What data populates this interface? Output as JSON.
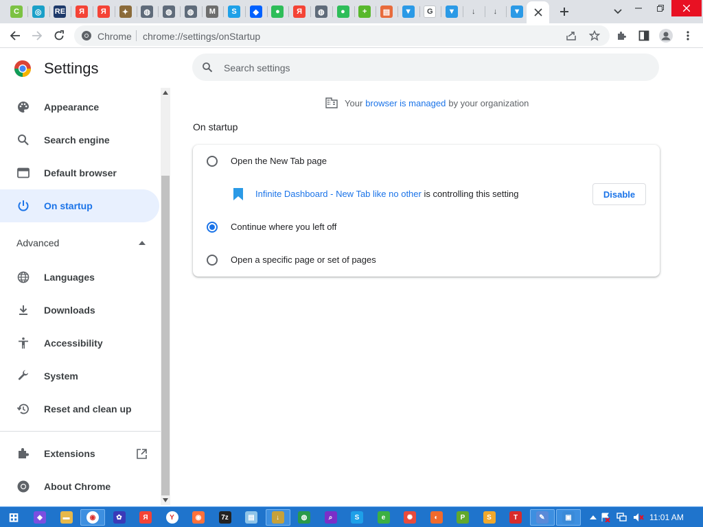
{
  "window": {
    "title": "Settings"
  },
  "tabs": [
    {
      "icon": "c-green-icon",
      "color": "#7cc243",
      "glyph": "C"
    },
    {
      "icon": "blue-square-icon",
      "color": "#1aa0c8",
      "glyph": "◎"
    },
    {
      "icon": "re-icon",
      "color": "#1e3a6a",
      "glyph": "RE"
    },
    {
      "icon": "yandex-icon",
      "color": "#f44336",
      "glyph": "Я"
    },
    {
      "icon": "yandex-icon",
      "color": "#f44336",
      "glyph": "Я"
    },
    {
      "icon": "bird-icon",
      "color": "#8b6b3a",
      "glyph": "✦"
    },
    {
      "icon": "globe-icon",
      "color": "#5f6b7a",
      "glyph": "◍"
    },
    {
      "icon": "globe-icon",
      "color": "#5f6b7a",
      "glyph": "◍"
    },
    {
      "icon": "globe-icon",
      "color": "#5f6b7a",
      "glyph": "◍"
    },
    {
      "icon": "m-icon",
      "color": "#6d6d6d",
      "glyph": "M"
    },
    {
      "icon": "skype-icon",
      "color": "#1ea0e8",
      "glyph": "S"
    },
    {
      "icon": "dropbox-icon",
      "color": "#0061ff",
      "glyph": "◆"
    },
    {
      "icon": "green-dot-icon",
      "color": "#2ebd59",
      "glyph": "●"
    },
    {
      "icon": "yandex-icon",
      "color": "#f44336",
      "glyph": "Я"
    },
    {
      "icon": "globe-icon",
      "color": "#5f6b7a",
      "glyph": "◍"
    },
    {
      "icon": "green-dot-icon",
      "color": "#2ebd59",
      "glyph": "●"
    },
    {
      "icon": "plus-circle-icon",
      "color": "#58b82c",
      "glyph": "+"
    },
    {
      "icon": "app-icon",
      "color": "#e86b3c",
      "glyph": "▤"
    },
    {
      "icon": "bookmark-icon",
      "color": "#2b9ae6",
      "glyph": "▼"
    },
    {
      "icon": "google-icon",
      "color": "#ffffff",
      "glyph": "G"
    },
    {
      "icon": "bookmark-icon",
      "color": "#2b9ae6",
      "glyph": "▼"
    },
    {
      "icon": "download-icon",
      "color": "#dee1e6",
      "glyph": "↓"
    },
    {
      "icon": "download-icon",
      "color": "#dee1e6",
      "glyph": "↓"
    },
    {
      "icon": "bookmark-icon",
      "color": "#2b9ae6",
      "glyph": "▼"
    }
  ],
  "toolbar": {
    "site_label": "Chrome",
    "url": "chrome://settings/onStartup"
  },
  "sidebar": {
    "title": "Settings",
    "items": [
      {
        "label": "Appearance",
        "icon": "palette-icon"
      },
      {
        "label": "Search engine",
        "icon": "search-icon"
      },
      {
        "label": "Default browser",
        "icon": "browser-window-icon"
      },
      {
        "label": "On startup",
        "icon": "power-icon"
      },
      {
        "label": "Advanced",
        "icon": "arrow-up-icon"
      },
      {
        "label": "Languages",
        "icon": "globe-icon"
      },
      {
        "label": "Downloads",
        "icon": "download-icon"
      },
      {
        "label": "Accessibility",
        "icon": "accessibility-icon"
      },
      {
        "label": "System",
        "icon": "wrench-icon"
      },
      {
        "label": "Reset and clean up",
        "icon": "history-icon"
      },
      {
        "label": "Extensions",
        "icon": "puzzle-icon"
      },
      {
        "label": "About Chrome",
        "icon": "chrome-icon"
      }
    ]
  },
  "search": {
    "placeholder": "Search settings"
  },
  "managed": {
    "prefix": "Your",
    "link": "browser is managed",
    "suffix": "by your organization"
  },
  "section": {
    "title": "On startup"
  },
  "options": [
    {
      "label": "Open the New Tab page",
      "selected": false
    },
    {
      "label": "Continue where you left off",
      "selected": true
    },
    {
      "label": "Open a specific page or set of pages",
      "selected": false
    }
  ],
  "extension_notice": {
    "link": "Infinite Dashboard - New Tab like no other",
    "text": " is controlling this setting",
    "button": "Disable"
  },
  "taskbar": {
    "clock": "11:01 AM",
    "apps": [
      {
        "icon": "windows-start-icon",
        "color": "#1f74cc",
        "glyph": "⊞"
      },
      {
        "icon": "purple-app-icon",
        "color": "#7b4fe0",
        "glyph": "◆"
      },
      {
        "icon": "file-explorer-icon",
        "color": "#e6b84a",
        "glyph": "▬"
      },
      {
        "icon": "chrome-icon",
        "color": "#ffffff",
        "glyph": "◉"
      },
      {
        "icon": "gear-app-icon",
        "color": "#3a3ab8",
        "glyph": "✿"
      },
      {
        "icon": "yandex-icon",
        "color": "#f44336",
        "glyph": "Я"
      },
      {
        "icon": "yandex-browser-icon",
        "color": "#ffffff",
        "glyph": "Y"
      },
      {
        "icon": "firefox-icon",
        "color": "#ff7139",
        "glyph": "◉"
      },
      {
        "icon": "7zip-icon",
        "color": "#222222",
        "glyph": "7z"
      },
      {
        "icon": "notepad-icon",
        "color": "#8fc4e8",
        "glyph": "▤"
      },
      {
        "icon": "download-app-icon",
        "color": "#c6a13a",
        "glyph": "↓"
      },
      {
        "icon": "globe-app-icon",
        "color": "#2a9a4a",
        "glyph": "◍"
      },
      {
        "icon": "search-app-icon",
        "color": "#7b2fc8",
        "glyph": "⌕"
      },
      {
        "icon": "skype-icon",
        "color": "#1ea0e8",
        "glyph": "S"
      },
      {
        "icon": "green-circle-icon",
        "color": "#3cb043",
        "glyph": "e"
      },
      {
        "icon": "colorful-icon",
        "color": "#e84b3c",
        "glyph": "✺"
      },
      {
        "icon": "swirl-icon",
        "color": "#f06a2c",
        "glyph": "◐"
      },
      {
        "icon": "p-icon",
        "color": "#62a82c",
        "glyph": "P"
      },
      {
        "icon": "s-icon",
        "color": "#f0a82c",
        "glyph": "S"
      },
      {
        "icon": "t-icon",
        "color": "#d82c2c",
        "glyph": "T"
      },
      {
        "icon": "pen-icon",
        "color": "#5a8ad8",
        "glyph": "✎"
      },
      {
        "icon": "monitor-icon",
        "color": "#3a8ad8",
        "glyph": "▣"
      }
    ]
  }
}
